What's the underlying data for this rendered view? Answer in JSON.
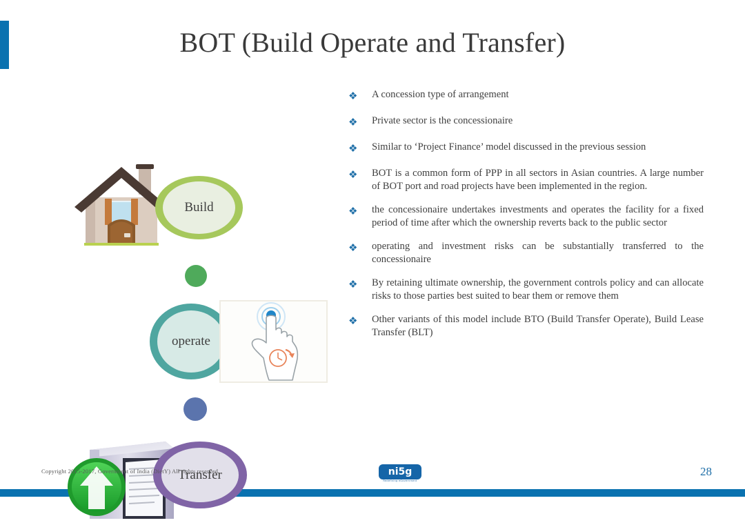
{
  "slide": {
    "title": "BOT (Build Operate and Transfer)",
    "page_number": "28",
    "accent_color": "#0a72b0"
  },
  "diagram": {
    "stages": [
      {
        "label": "Build",
        "ring_color": "#a6c85c",
        "inner_color": "#e9efe1",
        "icon": "house-icon"
      },
      {
        "label": "operate",
        "ring_color": "#4fa6a0",
        "inner_color": "#d7eae6",
        "icon": "tap-and-hold-hand-icon"
      },
      {
        "label": "Transfer",
        "ring_color": "#8064a6",
        "inner_color": "#e2e0ea",
        "icon": "server-upload-icon"
      }
    ],
    "connectors": [
      {
        "name": "dot-green",
        "color": "#4faa5b"
      },
      {
        "name": "dot-blue",
        "color": "#5b74ad"
      }
    ]
  },
  "bullets": {
    "glyph": "❖",
    "glyph_color": "#1f6fa8",
    "items": [
      "A concession type of arrangement",
      "Private sector is the  concessionaire",
      "Similar to ‘Project Finance’ model discussed in the previous session",
      "BOT is a common form of PPP in all sectors in Asian countries. A large number of BOT port and road projects have been implemented in the region.",
      "the concessionaire undertakes investments and operates the facility for a fixed period of time after which the ownership reverts back to the public sector",
      "operating and investment risks can be substantially transferred to the concessionaire",
      "By retaining ultimate ownership, the government controls policy and can allocate risks to those parties best suited to bear them or remove them",
      "Other variants of this model include BTO (Build Transfer Operate), Build Lease Transfer (BLT)"
    ]
  },
  "footer": {
    "copyright": "Copyright 2015-2017, Government of India (DietY) All rights reserved",
    "logo_text": "ni5g",
    "logo_tagline": "Redefining eGovernment"
  }
}
